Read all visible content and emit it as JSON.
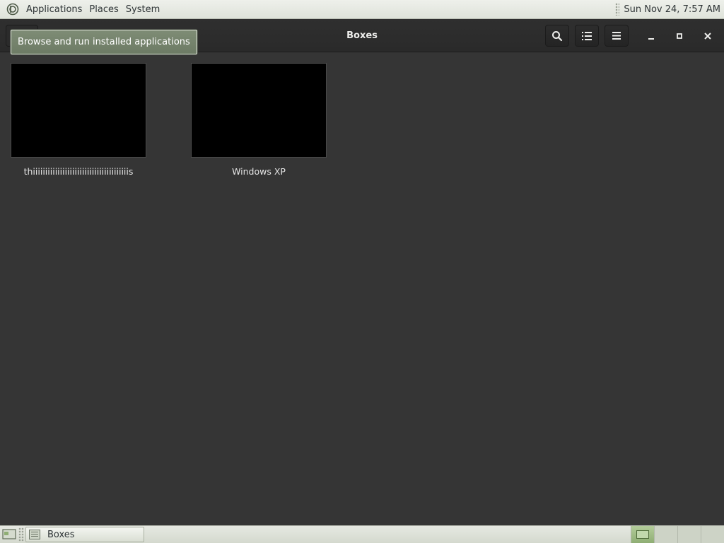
{
  "top_panel": {
    "menus": [
      "Applications",
      "Places",
      "System"
    ],
    "clock": "Sun Nov 24,  7:57 AM",
    "logo_icon": "gnome-foot-icon"
  },
  "window": {
    "title": "Boxes",
    "buttons": {
      "search_icon": "search-icon",
      "view_icon": "list-view-icon",
      "menu_icon": "hamburger-menu-icon",
      "minimize_icon": "minimize-icon",
      "maximize_icon": "maximize-icon",
      "close_icon": "close-icon"
    }
  },
  "tooltip": {
    "text": "Browse and run installed applications"
  },
  "boxes": [
    {
      "name": "thiiiiiiiiiiiiiiiiiiiiiiiiiiiiiiiiiiiiiiis"
    },
    {
      "name": "Windows XP"
    }
  ],
  "bottom_panel": {
    "task": {
      "label": "Boxes"
    },
    "workspaces_count": 4,
    "active_workspace": 1
  },
  "colors": {
    "content_bg": "#353535",
    "header_bg": "#2d2d2d",
    "tooltip_bg": "#76846d",
    "panel_bg": "#e6e9e2",
    "active_workspace": "#9fbd84"
  }
}
